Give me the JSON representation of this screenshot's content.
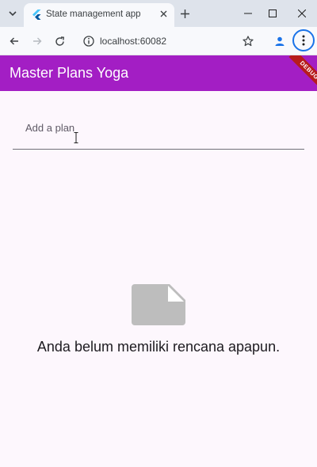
{
  "browser": {
    "tab_title": "State management app",
    "url": "localhost:60082"
  },
  "app": {
    "title": "Master Plans Yoga",
    "debug_label": "DEBUG",
    "input": {
      "placeholder": "Add a plan",
      "value": ""
    },
    "empty_message": "Anda belum memiliki rencana apapun."
  },
  "icons": {
    "tab_search": "chevron-down-icon",
    "favicon": "flutter-logo-icon",
    "close": "close-icon",
    "new_tab": "plus-icon",
    "minimize": "minimize-icon",
    "maximize": "maximize-icon",
    "close_window": "close-window-icon",
    "back": "back-arrow-icon",
    "forward": "forward-arrow-icon",
    "reload": "reload-icon",
    "site_info": "info-icon",
    "bookmark": "star-icon",
    "profile": "profile-icon",
    "menu": "more-vertical-icon",
    "empty_state": "note-icon"
  },
  "colors": {
    "appbar": "#a31ec4",
    "content_bg": "#fdf7fd",
    "accent": "#1a73e8",
    "empty_icon": "#bdbdbd"
  }
}
